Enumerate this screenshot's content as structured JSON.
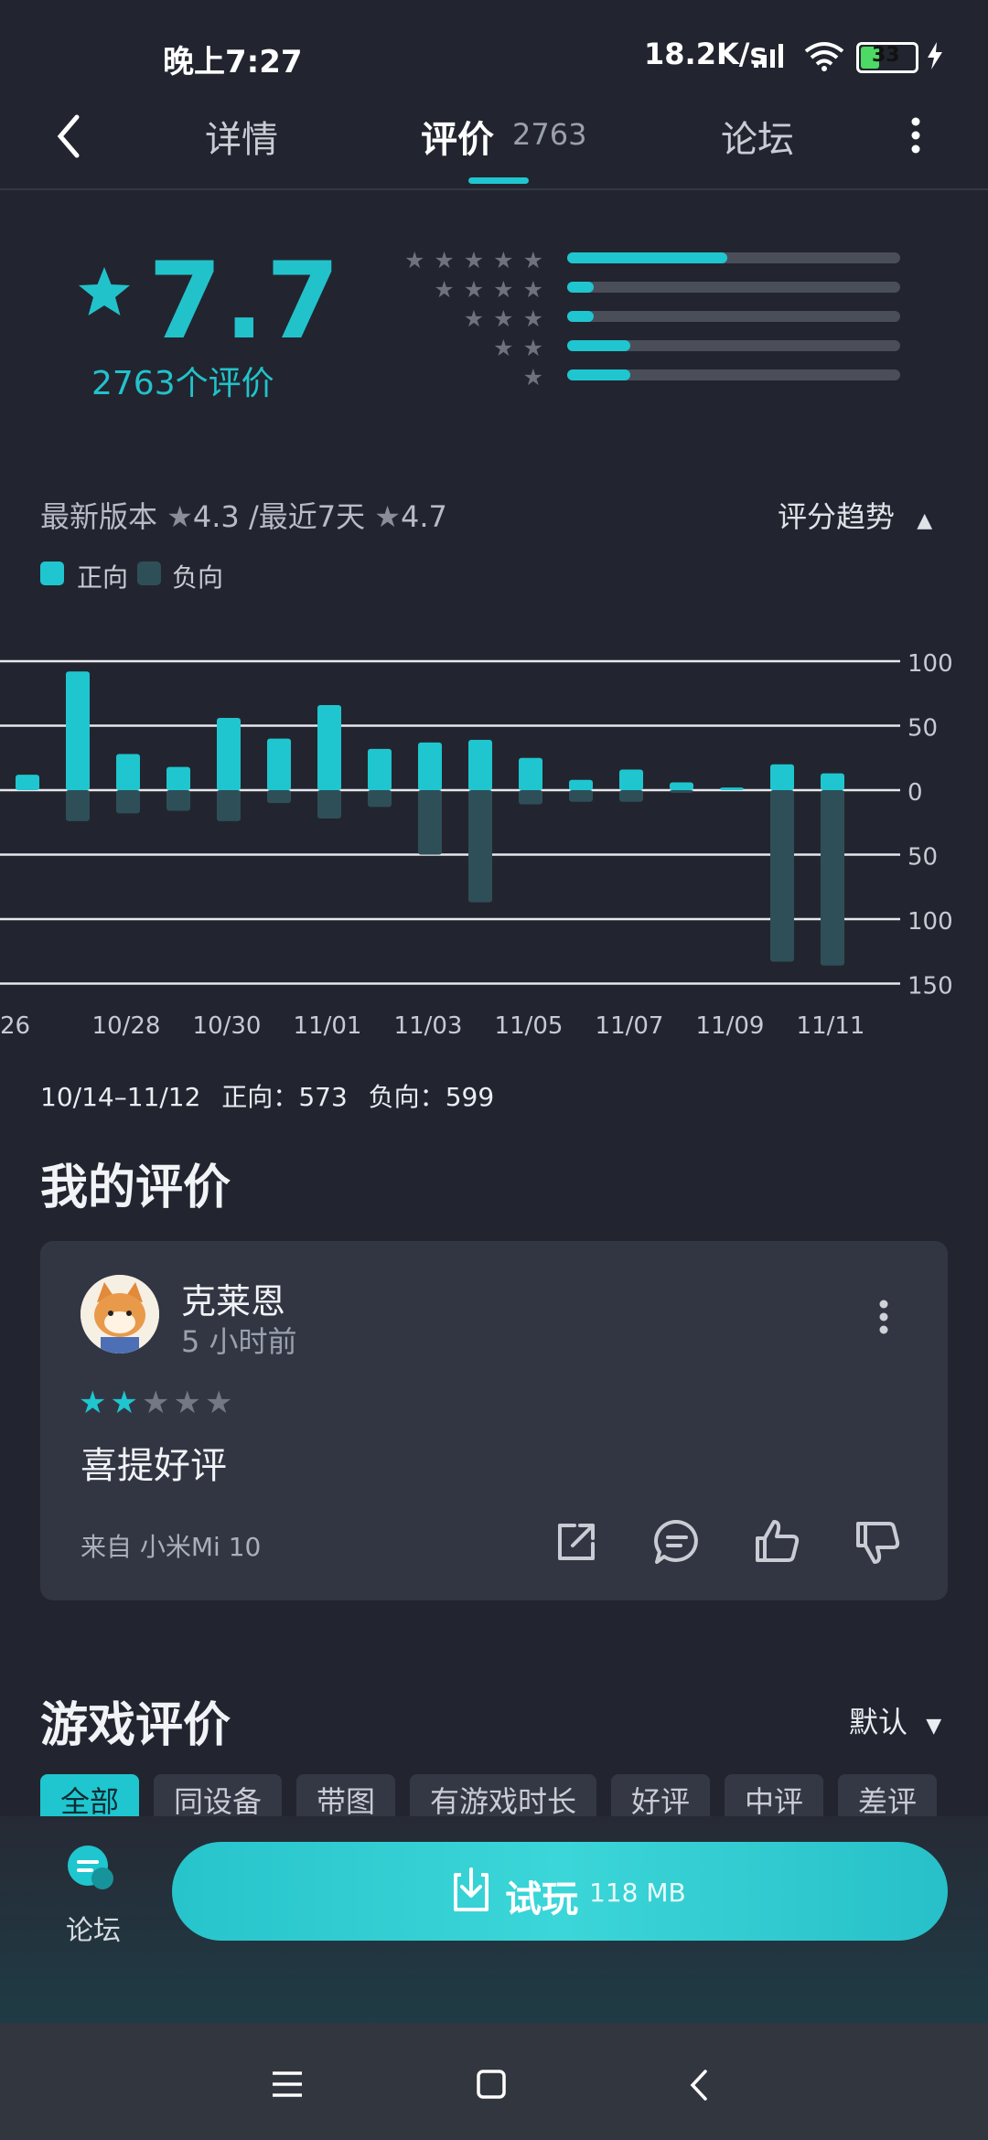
{
  "status_bar": {
    "time": "晚上7:27",
    "net_speed": "18.2K/s",
    "battery": "33"
  },
  "nav": {
    "tabs": [
      "详情",
      "评价",
      "论坛"
    ],
    "reviews_count": "2763",
    "active_tab": "评价"
  },
  "rating": {
    "score": "7.7",
    "count_label": "2763个评价",
    "distribution": [
      {
        "stars": 5,
        "fraction": 0.48
      },
      {
        "stars": 4,
        "fraction": 0.08
      },
      {
        "stars": 3,
        "fraction": 0.08
      },
      {
        "stars": 2,
        "fraction": 0.19
      },
      {
        "stars": 1,
        "fraction": 0.19
      }
    ]
  },
  "version_line": {
    "latest_label": "最新版本",
    "latest_score": "4.3",
    "separator": "/",
    "recent_label": "最近7天",
    "recent_score": "4.7"
  },
  "trend_toggle": "评分趋势",
  "legend": {
    "positive": "正向",
    "negative": "负向"
  },
  "chart_data": {
    "type": "bar",
    "dates": [
      "10/26",
      "10/27",
      "10/28",
      "10/29",
      "10/30",
      "10/31",
      "11/01",
      "11/02",
      "11/03",
      "11/04",
      "11/05",
      "11/06",
      "11/07",
      "11/08",
      "11/09",
      "11/10",
      "11/11",
      "11/12"
    ],
    "x_tick_labels": [
      "26",
      "10/28",
      "10/30",
      "11/01",
      "11/03",
      "11/05",
      "11/07",
      "11/09",
      "11/11"
    ],
    "series": [
      {
        "name": "正向",
        "values": [
          12,
          92,
          28,
          18,
          56,
          40,
          66,
          32,
          37,
          39,
          25,
          8,
          16,
          6,
          2,
          20,
          13,
          0
        ]
      },
      {
        "name": "负向",
        "values": [
          0,
          -24,
          -18,
          -16,
          -24,
          -10,
          -22,
          -13,
          -50,
          -87,
          -11,
          -9,
          -9,
          -2,
          0,
          -133,
          -136,
          0
        ]
      }
    ],
    "y_tick_labels": [
      "100",
      "50",
      "0",
      "50",
      "100",
      "150"
    ],
    "ylim": [
      -150,
      100
    ]
  },
  "date_range": {
    "range": "10/14–11/12",
    "positive_label": "正向：",
    "positive": "573",
    "negative_label": "负向：",
    "negative": "599"
  },
  "my_review": {
    "title": "我的评价",
    "user": "克莱恩",
    "time": "5 小时前",
    "stars": 2,
    "text": "喜提好评",
    "device": "来自 小米Mi 10"
  },
  "game_reviews": {
    "title": "游戏评价",
    "sort": "默认",
    "filters": [
      "全部",
      "同设备",
      "带图",
      "有游戏时长",
      "好评",
      "中评",
      "差评"
    ]
  },
  "bottom_bar": {
    "forum_label": "论坛",
    "play_label": "试玩",
    "play_size": "118 MB"
  },
  "colors": {
    "accent": "#1fc6cf",
    "negative": "#2e4f58",
    "background": "#22252f"
  }
}
